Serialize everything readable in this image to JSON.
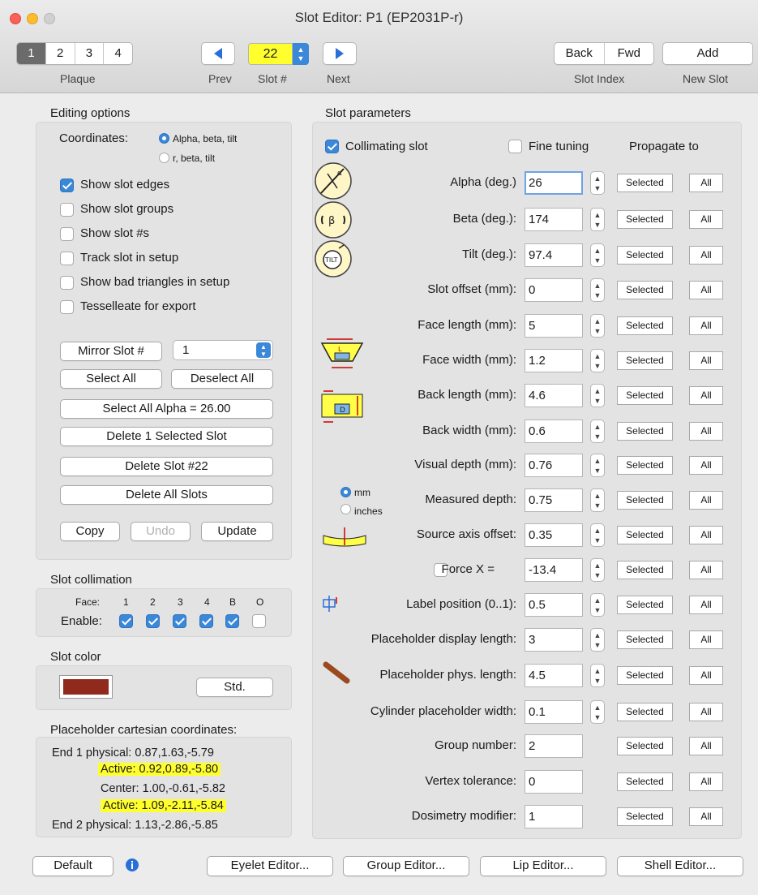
{
  "window": {
    "title": "Slot Editor: P1 (EP2031P-r)"
  },
  "toolbar": {
    "plaque_tabs": [
      "1",
      "2",
      "3",
      "4"
    ],
    "plaque_selected": "1",
    "plaque_label": "Plaque",
    "prev_label": "Prev",
    "slot_label": "Slot #",
    "slot_value": "22",
    "next_label": "Next",
    "back_label": "Back",
    "fwd_label": "Fwd",
    "slot_index_label": "Slot Index",
    "add_label": "Add",
    "new_slot_label": "New Slot"
  },
  "editing_options": {
    "heading": "Editing options",
    "coordinates_label": "Coordinates:",
    "coord_options": [
      "Alpha, beta, tilt",
      "r, beta, tilt"
    ],
    "coord_selected": "Alpha, beta, tilt",
    "checkboxes": [
      {
        "label": "Show slot edges",
        "checked": true
      },
      {
        "label": "Show slot groups",
        "checked": false
      },
      {
        "label": "Show slot #s",
        "checked": false
      },
      {
        "label": "Track slot in setup",
        "checked": false
      },
      {
        "label": "Show bad triangles in setup",
        "checked": false
      },
      {
        "label": "Tesselleate for export",
        "checked": false
      }
    ],
    "mirror_label": "Mirror Slot #",
    "mirror_value": "1",
    "select_all": "Select All",
    "deselect_all": "Deselect All",
    "select_alpha": "Select All Alpha = 26.00",
    "delete_selected": "Delete 1 Selected Slot",
    "delete_slot": "Delete Slot #22",
    "delete_all": "Delete All Slots",
    "copy": "Copy",
    "undo": "Undo",
    "update": "Update"
  },
  "collimation": {
    "heading": "Slot collimation",
    "face_label": "Face:",
    "enable_label": "Enable:",
    "faces": [
      {
        "name": "1",
        "enabled": true
      },
      {
        "name": "2",
        "enabled": true
      },
      {
        "name": "3",
        "enabled": true
      },
      {
        "name": "4",
        "enabled": true
      },
      {
        "name": "B",
        "enabled": true
      },
      {
        "name": "O",
        "enabled": false
      }
    ]
  },
  "slot_color": {
    "heading": "Slot color",
    "swatch": "#8f2a1c",
    "std_label": "Std."
  },
  "placeholder": {
    "heading": "Placeholder cartesian coordinates:",
    "rows": [
      {
        "label": "End 1 physical:",
        "value": "0.87,1.63,-5.79",
        "highlight": false
      },
      {
        "label": "Active:",
        "value": "0.92,0.89,-5.80",
        "highlight": true
      },
      {
        "label": "Center:",
        "value": "1.00,-0.61,-5.82",
        "highlight": false
      },
      {
        "label": "Active:",
        "value": "1.09,-2.11,-5.84",
        "highlight": true
      },
      {
        "label": "End 2 physical:",
        "value": "1.13,-2.86,-5.85",
        "highlight": false
      }
    ]
  },
  "params": {
    "heading": "Slot parameters",
    "collimating_label": "Collimating slot",
    "collimating_checked": true,
    "fine_tuning_label": "Fine tuning",
    "fine_tuning_checked": false,
    "propagate_label": "Propagate to",
    "selected_label": "Selected",
    "all_label": "All",
    "units": {
      "mm": "mm",
      "inches": "inches",
      "selected": "mm"
    },
    "force_checked": false,
    "rows": [
      {
        "label": "Alpha (deg.)",
        "value": "26",
        "stepper": true
      },
      {
        "label": "Beta (deg.):",
        "value": "174",
        "stepper": true
      },
      {
        "label": "Tilt (deg.):",
        "value": "97.4",
        "stepper": true
      },
      {
        "label": "Slot offset (mm):",
        "value": "0",
        "stepper": true
      },
      {
        "label": "Face length (mm):",
        "value": "5",
        "stepper": true
      },
      {
        "label": "Face width (mm):",
        "value": "1.2",
        "stepper": true
      },
      {
        "label": "Back length (mm):",
        "value": "4.6",
        "stepper": true
      },
      {
        "label": "Back width (mm):",
        "value": "0.6",
        "stepper": true
      },
      {
        "label": "Visual depth (mm):",
        "value": "0.76",
        "stepper": true
      },
      {
        "label": "Measured depth:",
        "value": "0.75",
        "stepper": true
      },
      {
        "label": "Source axis offset:",
        "value": "0.35",
        "stepper": true
      },
      {
        "label": "Force X =",
        "value": "-13.4",
        "stepper": true
      },
      {
        "label": "Label position (0..1):",
        "value": "0.5",
        "stepper": true
      },
      {
        "label": "Placeholder display length:",
        "value": "3",
        "stepper": true
      },
      {
        "label": "Placeholder phys. length:",
        "value": "4.5",
        "stepper": true
      },
      {
        "label": "Cylinder placeholder width:",
        "value": "0.1",
        "stepper": true
      },
      {
        "label": "Group number:",
        "value": "2",
        "stepper": false
      },
      {
        "label": "Vertex tolerance:",
        "value": "0",
        "stepper": false
      },
      {
        "label": "Dosimetry  modifier:",
        "value": "1",
        "stepper": false
      }
    ]
  },
  "footer": {
    "default": "Default",
    "eyelet": "Eyelet Editor...",
    "group": "Group Editor...",
    "lip": "Lip Editor...",
    "shell": "Shell Editor..."
  },
  "colors": {
    "accent": "#3b87d8",
    "highlight": "#ffff2e",
    "swatch": "#8f2a1c"
  }
}
